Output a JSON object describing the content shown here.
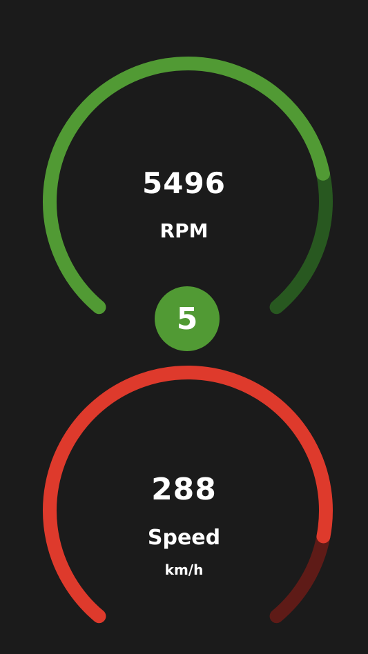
{
  "rpm_gauge": {
    "value": "5496",
    "label": "RPM",
    "fill_fraction": 0.78,
    "color_active": "#519a34",
    "color_track": "#285820"
  },
  "gear_indicator": {
    "value": "5",
    "color": "#519a34"
  },
  "speed_gauge": {
    "value": "288",
    "label": "Speed",
    "unit": "km/h",
    "fill_fraction": 0.86,
    "color_active": "#de3a2c",
    "color_track": "#5e1b17"
  },
  "background_color": "#1b1b1b"
}
